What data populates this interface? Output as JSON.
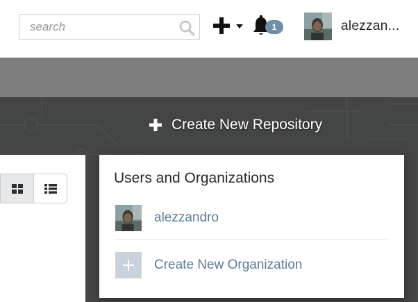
{
  "header": {
    "search": {
      "placeholder": "search",
      "value": ""
    },
    "notifications": {
      "count": "1"
    },
    "user": {
      "name": "alezzan..."
    }
  },
  "banner": {
    "create_repo_label": "Create New Repository"
  },
  "dropdown": {
    "title": "Users and Organizations",
    "items": [
      {
        "label": "alezzandro"
      },
      {
        "label": "Create New Organization"
      }
    ]
  },
  "colors": {
    "banner_dark": "#444645",
    "banner_gray": "#7e7e7e",
    "link": "#5c7b99",
    "badge": "#6f8ea8"
  }
}
